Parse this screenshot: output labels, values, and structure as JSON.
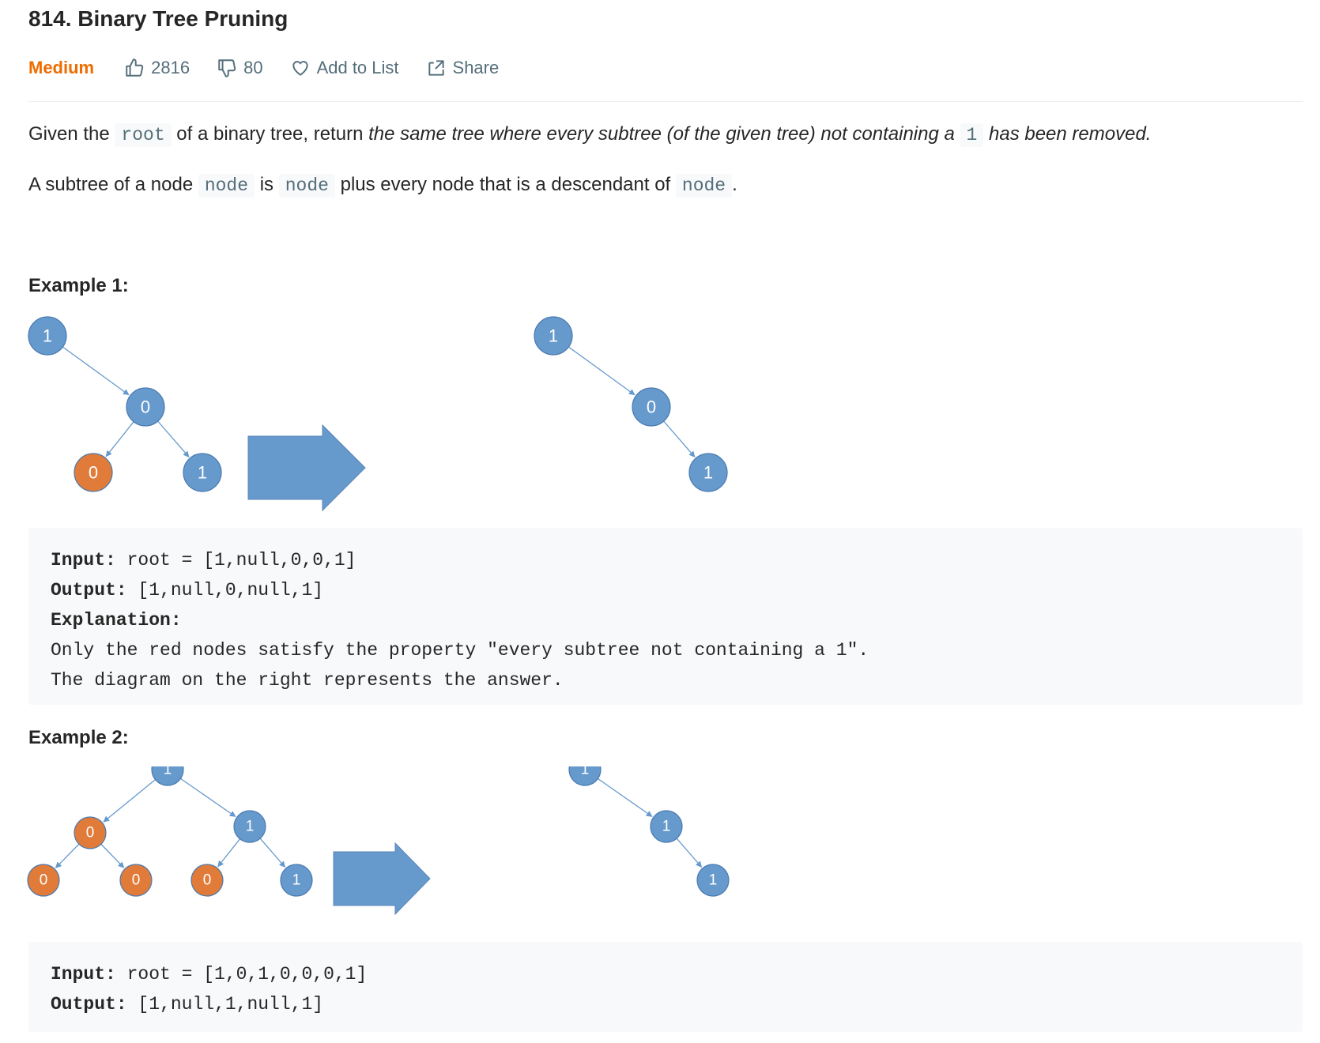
{
  "problem": {
    "title": "814. Binary Tree Pruning",
    "difficulty": "Medium",
    "likes": "2816",
    "dislikes": "80",
    "add_to_list": "Add to List",
    "share": "Share"
  },
  "description": {
    "p1_before": "Given the ",
    "p1_code1": "root",
    "p1_mid": " of a binary tree, return ",
    "p1_em1": "the same tree where every subtree (of the given tree) not containing a ",
    "p1_code2": "1",
    "p1_em2": " has been removed",
    "p1_end": ".",
    "p2_before": "A subtree of a node ",
    "p2_code1": "node",
    "p2_mid1": " is ",
    "p2_code2": "node",
    "p2_mid2": " plus every node that is a descendant of ",
    "p2_code3": "node",
    "p2_end": "."
  },
  "example1": {
    "heading": "Example 1:",
    "input_label": "Input:",
    "input_value": " root = [1,null,0,0,1]",
    "output_label": "Output:",
    "output_value": " [1,null,0,null,1]",
    "explanation_label": "Explanation:",
    "explanation_line1": "Only the red nodes satisfy the property \"every subtree not containing a 1\".",
    "explanation_line2": "The diagram on the right represents the answer.",
    "left_tree": [
      {
        "value": "1",
        "color": "#6699cc"
      },
      {
        "value": "0",
        "color": "#6699cc"
      },
      {
        "value": "0",
        "color": "#e07b39"
      },
      {
        "value": "1",
        "color": "#6699cc"
      }
    ],
    "right_tree": [
      {
        "value": "1",
        "color": "#6699cc"
      },
      {
        "value": "0",
        "color": "#6699cc"
      },
      {
        "value": "1",
        "color": "#6699cc"
      }
    ]
  },
  "example2": {
    "heading": "Example 2:",
    "input_label": "Input:",
    "input_value": " root = [1,0,1,0,0,0,1]",
    "output_label": "Output:",
    "output_value": " [1,null,1,null,1]",
    "left_tree": [
      {
        "value": "1",
        "color": "#6699cc"
      },
      {
        "value": "0",
        "color": "#e07b39"
      },
      {
        "value": "1",
        "color": "#6699cc"
      },
      {
        "value": "0",
        "color": "#e07b39"
      },
      {
        "value": "0",
        "color": "#e07b39"
      },
      {
        "value": "0",
        "color": "#e07b39"
      },
      {
        "value": "1",
        "color": "#6699cc"
      }
    ],
    "right_tree": [
      {
        "value": "1",
        "color": "#6699cc"
      },
      {
        "value": "1",
        "color": "#6699cc"
      },
      {
        "value": "1",
        "color": "#6699cc"
      }
    ]
  },
  "colors": {
    "kept_node": "#6699cc",
    "pruned_node": "#e07b39",
    "arrow": "#6699cc",
    "difficulty": "#ef6c00"
  }
}
